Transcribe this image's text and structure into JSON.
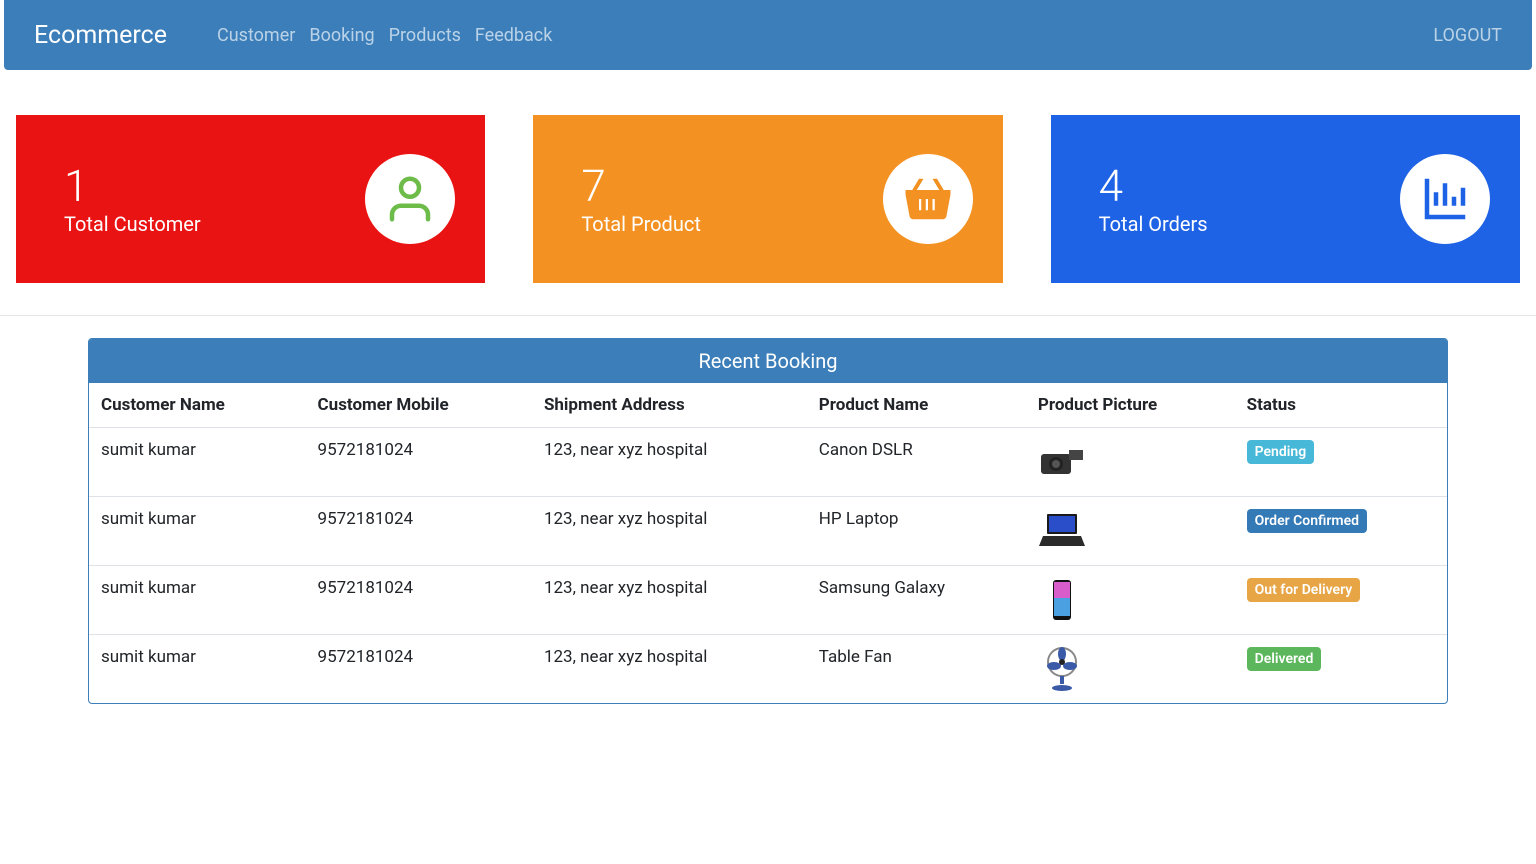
{
  "navbar": {
    "brand": "Ecommerce",
    "links": [
      "Customer",
      "Booking",
      "Products",
      "Feedback"
    ],
    "logout": "LOGOUT"
  },
  "stats": {
    "customer": {
      "value": "1",
      "label": "Total Customer"
    },
    "product": {
      "value": "7",
      "label": "Total Product"
    },
    "orders": {
      "value": "4",
      "label": "Total Orders"
    }
  },
  "table": {
    "title": "Recent Booking",
    "headers": [
      "Customer Name",
      "Customer Mobile",
      "Shipment Address",
      "Product Name",
      "Product Picture",
      "Status"
    ],
    "rows": [
      {
        "name": "sumit kumar",
        "mobile": "9572181024",
        "address": "123, near xyz hospital",
        "product": "Canon DSLR",
        "picture": "camera",
        "status": "Pending",
        "statusClass": "badge-pending"
      },
      {
        "name": "sumit kumar",
        "mobile": "9572181024",
        "address": "123, near xyz hospital",
        "product": "HP Laptop",
        "picture": "laptop",
        "status": "Order Confirmed",
        "statusClass": "badge-confirmed"
      },
      {
        "name": "sumit kumar",
        "mobile": "9572181024",
        "address": "123, near xyz hospital",
        "product": "Samsung Galaxy",
        "picture": "phone",
        "status": "Out for Delivery",
        "statusClass": "badge-out"
      },
      {
        "name": "sumit kumar",
        "mobile": "9572181024",
        "address": "123, near xyz hospital",
        "product": "Table Fan",
        "picture": "fan",
        "status": "Delivered",
        "statusClass": "badge-delivered"
      }
    ]
  }
}
